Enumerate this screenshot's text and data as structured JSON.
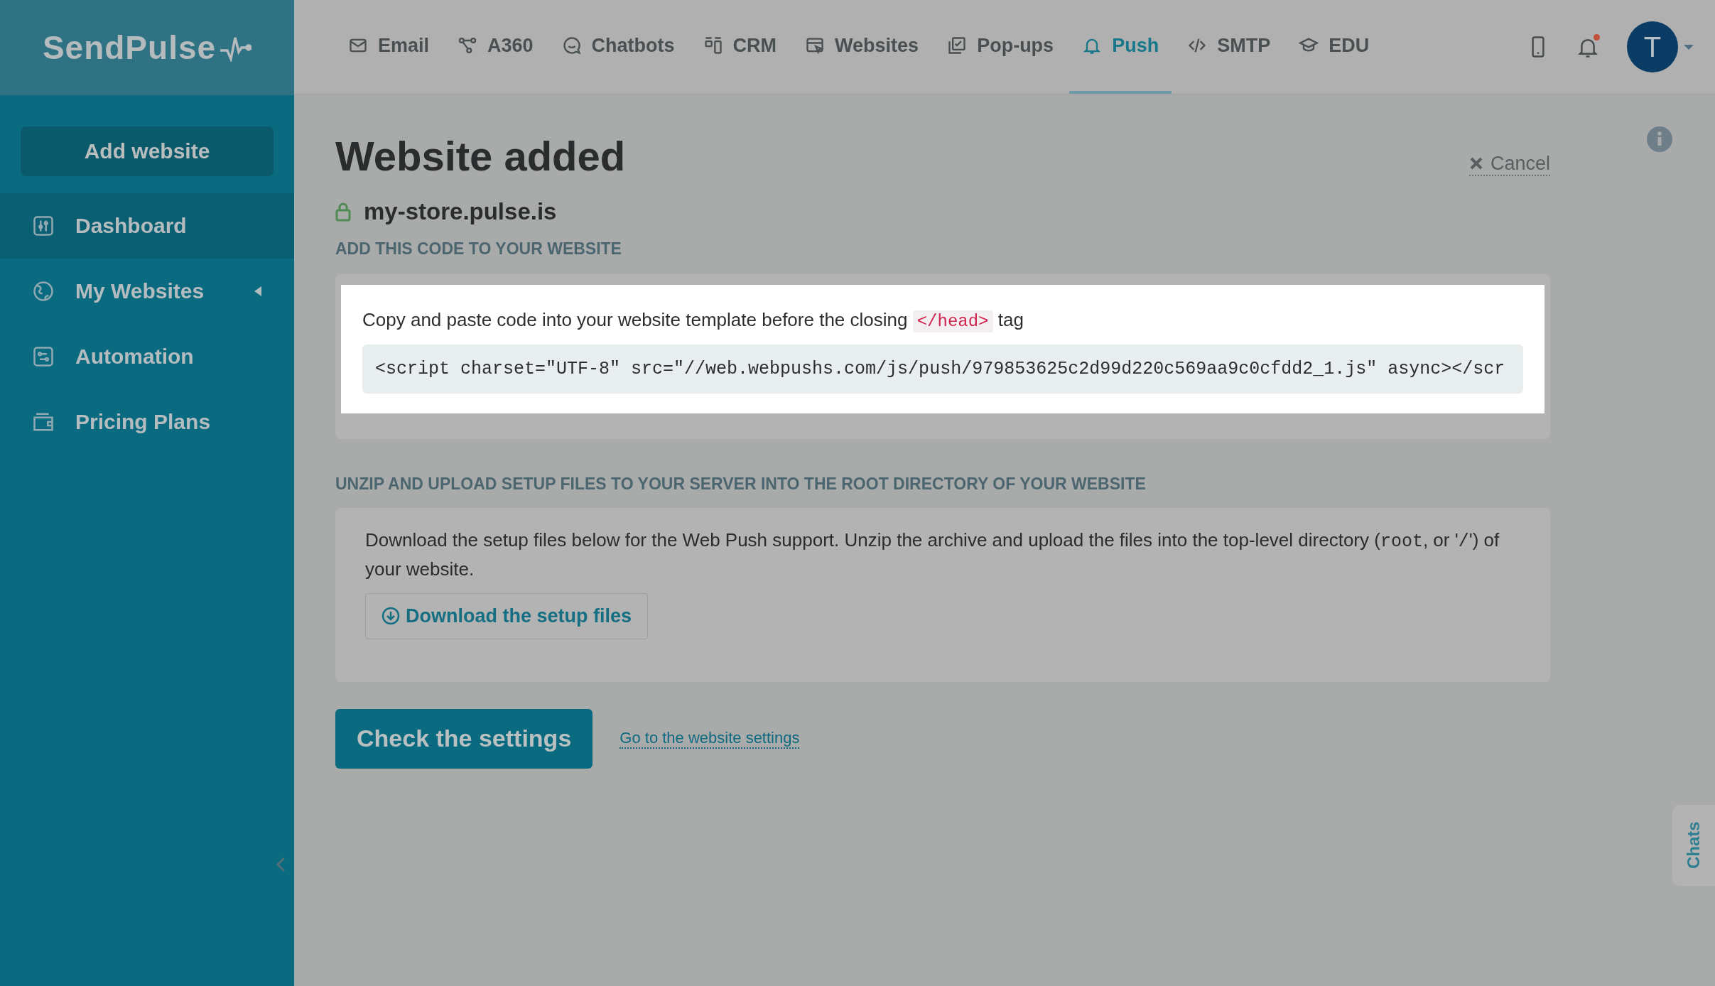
{
  "logo": {
    "text": "SendPulse"
  },
  "nav": [
    {
      "label": "Email",
      "selected": false
    },
    {
      "label": "A360",
      "selected": false
    },
    {
      "label": "Chatbots",
      "selected": false
    },
    {
      "label": "CRM",
      "selected": false
    },
    {
      "label": "Websites",
      "selected": false
    },
    {
      "label": "Pop-ups",
      "selected": false
    },
    {
      "label": "Push",
      "selected": true
    },
    {
      "label": "SMTP",
      "selected": false
    },
    {
      "label": "EDU",
      "selected": false
    }
  ],
  "notifications": {
    "unread": true
  },
  "avatar": {
    "initial": "T"
  },
  "sidebar": {
    "button": "Add website",
    "items": [
      {
        "label": "Dashboard",
        "selected": true,
        "expandable": false
      },
      {
        "label": "My Websites",
        "selected": false,
        "expandable": true
      },
      {
        "label": "Automation",
        "selected": false,
        "expandable": false
      },
      {
        "label": "Pricing Plans",
        "selected": false,
        "expandable": false
      }
    ]
  },
  "page": {
    "title": "Website added",
    "cancel": "Cancel",
    "domain": "my-store.pulse.is",
    "code_section": {
      "heading": "ADD THIS CODE TO YOUR WEBSITE",
      "intro": [
        {
          "kind": "text",
          "text": "Copy and paste code into your website template before the closing "
        },
        {
          "kind": "code",
          "text": "</head>"
        },
        {
          "kind": "text",
          "text": " tag"
        }
      ],
      "code": "<script charset=\"UTF-8\" src=\"//web.webpushs.com/js/push/979853625c2d99d220c569aa9c0cfdd2_1.js\" async></scr"
    },
    "files_section": {
      "heading": "UNZIP AND UPLOAD SETUP FILES TO YOUR SERVER INTO THE ROOT DIRECTORY OF YOUR WEBSITE",
      "intro": [
        {
          "kind": "text",
          "text": "Download the setup files below for the Web Push support. Unzip the archive and upload the files into the top-level directory ("
        },
        {
          "kind": "mono",
          "text": "root"
        },
        {
          "kind": "text",
          "text": ", or '"
        },
        {
          "kind": "mono",
          "text": "/"
        },
        {
          "kind": "text",
          "text": "') of your website."
        }
      ],
      "button": "Download the setup files"
    },
    "primary_button": "Check the settings",
    "link": "Go to the website settings"
  },
  "chats_tab": "Chats"
}
